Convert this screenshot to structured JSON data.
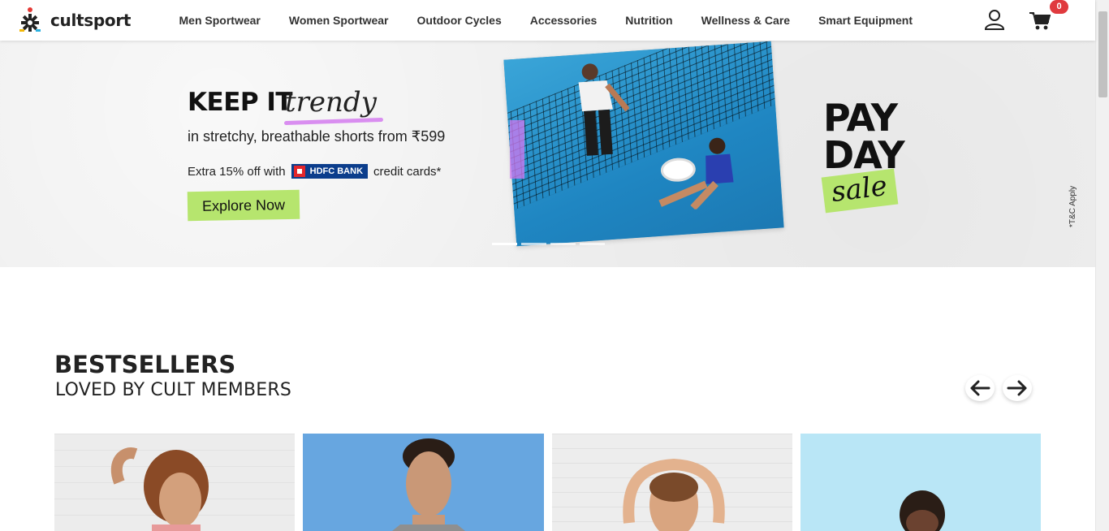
{
  "header": {
    "brand": "cultsport",
    "nav": [
      "Men Sportwear",
      "Women Sportwear",
      "Outdoor Cycles",
      "Accessories",
      "Nutrition",
      "Wellness & Care",
      "Smart Equipment"
    ],
    "user_icon": "user-icon",
    "cart_icon": "cart-icon",
    "cart_count": "0"
  },
  "banner": {
    "headline": "KEEP IT",
    "headline_accent": "trendy",
    "subline": "in stretchy, breathable shorts from ₹599",
    "offer_prefix": "Extra 15% off with",
    "bank_name": "HDFC BANK",
    "offer_suffix": "credit cards*",
    "cta": "Explore Now",
    "pay_line1": "PAY",
    "pay_line2": "DAY",
    "sale": "sale",
    "terms": "*T&C Apply",
    "slide_count": 4,
    "active_slide": 1,
    "colors": {
      "accent_green": "#b6e56e",
      "accent_purple": "#d98ef0",
      "bank_blue": "#0b3d8c",
      "bank_red": "#e3262b"
    }
  },
  "bestsellers": {
    "title": "BESTSELLERS",
    "subtitle": "LOVED BY CULT MEMBERS",
    "prev_icon": "arrow-left-icon",
    "next_icon": "arrow-right-icon"
  }
}
